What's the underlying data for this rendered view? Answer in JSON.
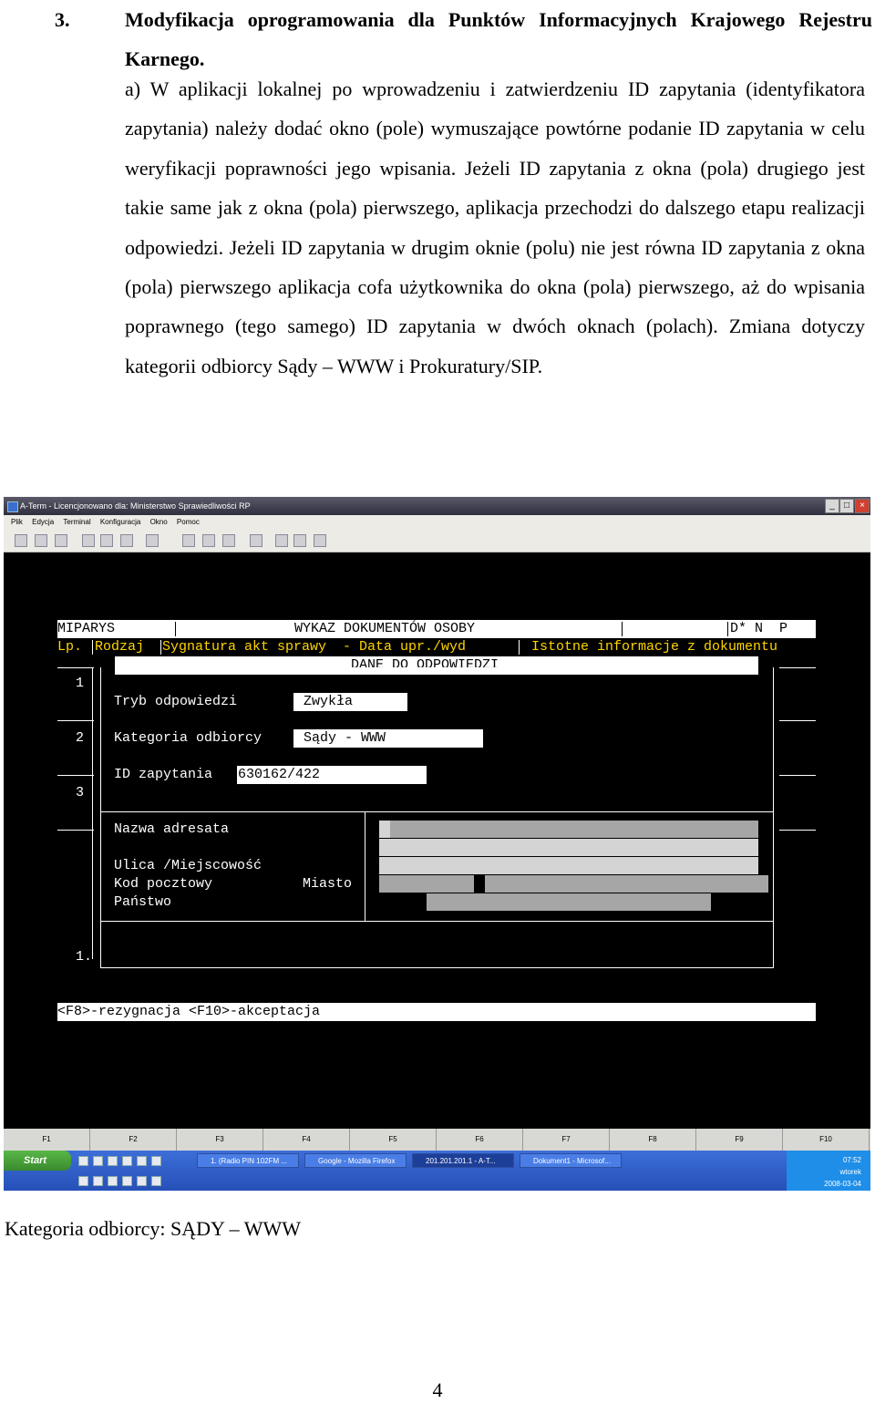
{
  "document": {
    "heading_number": "3.",
    "heading_text": "Modyfikacja oprogramowania dla Punktów Informacyjnych Krajowego Rejestru Karnego.",
    "paragraph": "a) W aplikacji lokalnej po wprowadzeniu i zatwierdzeniu ID zapytania (identyfikatora zapytania) należy dodać okno (pole) wymuszające powtórne podanie ID zapytania w celu weryfikacji poprawności jego wpisania. Jeżeli ID zapytania z okna (pola) drugiego jest takie same jak z okna (pola) pierwszego, aplikacja przechodzi do dalszego etapu realizacji odpowiedzi. Jeżeli ID zapytania w drugim oknie (polu) nie jest równa ID zapytania z okna (pola) pierwszego aplikacja cofa użytkownika do okna (pola) pierwszego, aż do wpisania poprawnego (tego samego) ID zapytania w dwóch oknach (polach). Zmiana dotyczy kategorii odbiorcy Sądy – WWW i Prokuratury/SIP.",
    "caption": "Kategoria odbiorcy: SĄDY – WWW",
    "page_number": "4"
  },
  "window": {
    "title": "A-Term - Licencjonowano dla: Ministerstwo Sprawiedliwości RP",
    "menu": [
      "Plik",
      "Edycja",
      "Terminal",
      "Konfiguracja",
      "Okno",
      "Pomoc"
    ]
  },
  "terminal": {
    "header_left": "MIPARYS",
    "header_center": "WYKAZ DOKUMENTÓW OSOBY",
    "header_right": "D* N  P",
    "col_lp": "Lp.",
    "col_rodzaj": "Rodzaj",
    "col_sygnatura": "Sygnatura akt sprawy  - Data upr./wyd",
    "col_istotne": "Istotne informacje z dokumentu",
    "dialog_title": "DANE DO ODPOWIEDZI",
    "row_numbers": [
      "1",
      "2",
      "3",
      "1."
    ],
    "tryb_label": "Tryb odpowiedzi",
    "tryb_value": "Zwykła",
    "kategoria_label": "Kategoria odbiorcy",
    "kategoria_value": "Sądy - WWW",
    "id_label": "ID zapytania",
    "id_value": "630162/422",
    "nazwa_label": "Nazwa adresata",
    "ulica_label": "Ulica /Miejscowość",
    "kod_label": "Kod pocztowy",
    "miasto_label": "Miasto",
    "panstwo_label": "Państwo",
    "footer": "<F8>-rezygnacja <F10>-akceptacja"
  },
  "fkeys": [
    "F1",
    "F2",
    "F3",
    "F4",
    "F5",
    "F6",
    "F7",
    "F8",
    "F9",
    "F10"
  ],
  "taskbar": {
    "start": "Start",
    "tasks": [
      "1. (Radio PIN 102FM ...",
      "Google - Mozilla Firefox",
      "201.201.201.1 - A-T...",
      "Dokument1 - Microsof..."
    ],
    "clock_time": "07:52",
    "clock_day": "wtorek",
    "clock_date": "2008-03-04"
  }
}
